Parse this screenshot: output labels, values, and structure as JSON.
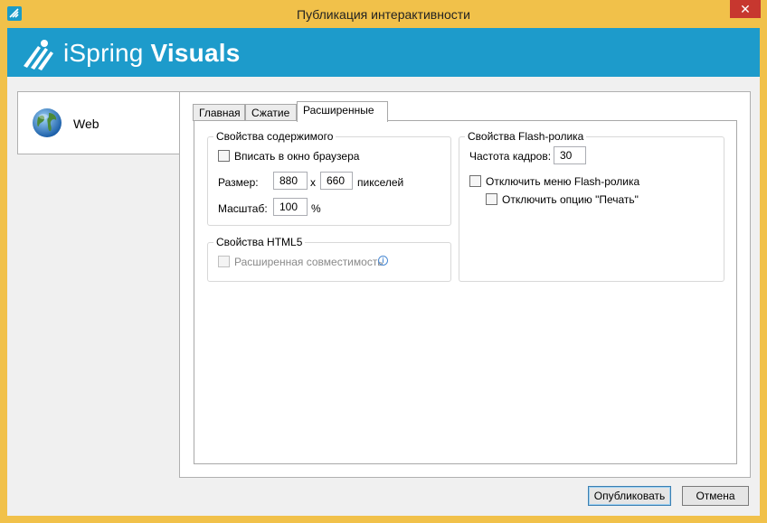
{
  "window": {
    "title": "Публикация интерактивности",
    "close_glyph": "✕",
    "accent_color": "#1d9bcb",
    "frame_color": "#f1c14a"
  },
  "banner": {
    "brand_light": "iSpring",
    "brand_bold": "Visuals"
  },
  "sidebar": {
    "items": [
      {
        "label": "Web",
        "icon": "globe-icon"
      }
    ]
  },
  "tabs": [
    {
      "label": "Главная"
    },
    {
      "label": "Сжатие"
    },
    {
      "label": "Расширенные"
    }
  ],
  "content_group": {
    "title": "Свойства содержимого",
    "fit_browser_label": "Вписать в окно браузера",
    "fit_browser_checked": false,
    "size_label": "Размер:",
    "width_value": "880",
    "times": "x",
    "height_value": "660",
    "pixels_label": "пикселей",
    "scale_label": "Масштаб:",
    "scale_value": "100",
    "percent": "%"
  },
  "html5_group": {
    "title": "Свойства HTML5",
    "compat_label": "Расширенная совместимость",
    "compat_checked": false,
    "info_glyph": "i"
  },
  "flash_group": {
    "title": "Свойства Flash-ролика",
    "fps_label": "Частота кадров:",
    "fps_value": "30",
    "disable_menu_label": "Отключить меню Flash-ролика",
    "disable_print_label": "Отключить опцию \"Печать\""
  },
  "footer": {
    "publish_label": "Опубликовать",
    "cancel_label": "Отмена"
  }
}
